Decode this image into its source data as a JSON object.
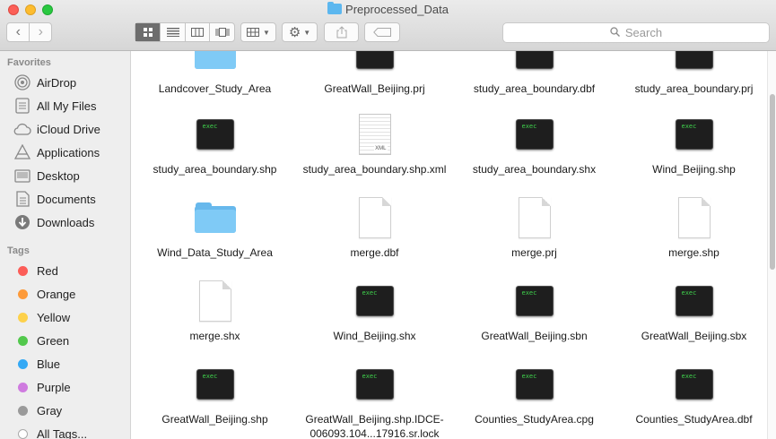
{
  "window": {
    "title": "Preprocessed_Data"
  },
  "toolbar": {
    "back_icon": "‹",
    "forward_icon": "›",
    "view_modes": [
      "icon-view",
      "list-view",
      "column-view",
      "cover-flow-view"
    ],
    "active_view": "icon-view",
    "search_placeholder": "Search"
  },
  "sidebar": {
    "favorites_header": "Favorites",
    "favorites": [
      {
        "label": "AirDrop",
        "icon": "airdrop-icon"
      },
      {
        "label": "All My Files",
        "icon": "all-files-icon"
      },
      {
        "label": "iCloud Drive",
        "icon": "cloud-icon"
      },
      {
        "label": "Applications",
        "icon": "applications-icon"
      },
      {
        "label": "Desktop",
        "icon": "desktop-icon"
      },
      {
        "label": "Documents",
        "icon": "documents-icon"
      },
      {
        "label": "Downloads",
        "icon": "downloads-icon"
      }
    ],
    "tags_header": "Tags",
    "tags": [
      {
        "label": "Red",
        "color": "#fc5d58"
      },
      {
        "label": "Orange",
        "color": "#fd9a3a"
      },
      {
        "label": "Yellow",
        "color": "#fdd14b"
      },
      {
        "label": "Green",
        "color": "#52c84c"
      },
      {
        "label": "Blue",
        "color": "#34a9f5"
      },
      {
        "label": "Purple",
        "color": "#cf7bdf"
      },
      {
        "label": "Gray",
        "color": "#9a9a9a"
      },
      {
        "label": "All Tags...",
        "color": "#ffffff"
      }
    ]
  },
  "files": [
    {
      "name": "Landcover_Study_Area",
      "type": "folder"
    },
    {
      "name": "GreatWall_Beijing.prj",
      "type": "exec"
    },
    {
      "name": "study_area_boundary.dbf",
      "type": "exec"
    },
    {
      "name": "study_area_boundary.prj",
      "type": "exec"
    },
    {
      "name": "study_area_boundary.shp",
      "type": "exec"
    },
    {
      "name": "study_area_boundary.shp.xml",
      "type": "xml"
    },
    {
      "name": "study_area_boundary.shx",
      "type": "exec"
    },
    {
      "name": "Wind_Beijing.shp",
      "type": "exec"
    },
    {
      "name": "Wind_Data_Study_Area",
      "type": "folder"
    },
    {
      "name": "merge.dbf",
      "type": "doc"
    },
    {
      "name": "merge.prj",
      "type": "doc"
    },
    {
      "name": "merge.shp",
      "type": "doc"
    },
    {
      "name": "merge.shx",
      "type": "doc"
    },
    {
      "name": "Wind_Beijing.shx",
      "type": "exec"
    },
    {
      "name": "GreatWall_Beijing.sbn",
      "type": "exec"
    },
    {
      "name": "GreatWall_Beijing.sbx",
      "type": "exec"
    },
    {
      "name": "GreatWall_Beijing.shp",
      "type": "exec"
    },
    {
      "name": "GreatWall_Beijing.shp.IDCE-006093.104...17916.sr.lock",
      "type": "exec"
    },
    {
      "name": "Counties_StudyArea.cpg",
      "type": "exec"
    },
    {
      "name": "Counties_StudyArea.dbf",
      "type": "exec"
    }
  ],
  "exec_label": "exec",
  "xml_label": "XML"
}
